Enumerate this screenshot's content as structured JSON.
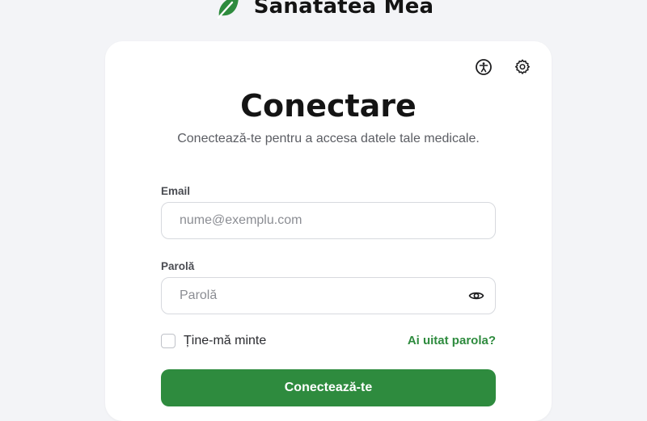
{
  "brand": {
    "name": "Sanatatea Mea",
    "logo_icon": "leaf-icon",
    "logo_color": "#2e8b3e"
  },
  "card": {
    "top_icons": [
      "accessibility-icon",
      "gear-icon"
    ],
    "title": "Conectare",
    "subtitle": "Conectează-te pentru a accesa datele tale medicale."
  },
  "form": {
    "email": {
      "label": "Email",
      "value": "",
      "placeholder": "nume@exemplu.com"
    },
    "password": {
      "label": "Parolă",
      "value": "",
      "placeholder": "Parolă",
      "toggle_icon": "eye-icon"
    },
    "remember": {
      "label": "Ține-mă minte",
      "checked": false
    },
    "forgot_link": "Ai uitat parola?",
    "submit_label": "Conectează-te"
  },
  "colors": {
    "accent": "#2e8b3e",
    "background": "#f3f4f7",
    "card": "#ffffff"
  }
}
